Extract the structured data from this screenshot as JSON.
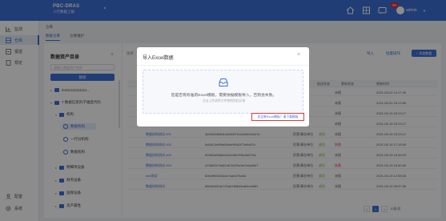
{
  "app": {
    "title": "PBC-DRAS",
    "subtitle": "人行数据上报",
    "notif_count": "99",
    "username": "admin"
  },
  "nav": [
    {
      "label": "监测",
      "icon": "chart-icon"
    },
    {
      "label": "仓库",
      "icon": "database-icon"
    },
    {
      "label": "报送",
      "icon": "send-icon"
    },
    {
      "label": "规定",
      "icon": "doc-icon"
    },
    {
      "label": "配置",
      "icon": "user-icon"
    },
    {
      "label": "系统",
      "icon": "gear-icon"
    }
  ],
  "breadcrumb": "仓库",
  "tabs": [
    {
      "label": "数据仓库"
    },
    {
      "label": "仓库维护"
    }
  ],
  "tree": {
    "title": "数据资产目录",
    "search_placeholder": "请输入数据资产名称",
    "button_label": "搜索",
    "nodes": [
      {
        "label": "test11111111111..."
      },
      {
        "label": "7 数据信息的子维度代码"
      },
      {
        "label": "机构"
      },
      {
        "label": "数据机构"
      },
      {
        "label": "一行分机构"
      },
      {
        "label": "数据机构"
      },
      {
        "label": "明细项设备"
      },
      {
        "label": "财务设备"
      },
      {
        "label": "国保设备"
      },
      {
        "label": "资产属性"
      }
    ]
  },
  "toolbar": {
    "search_placeholder": "搜索",
    "tools": [
      "导入",
      "批量操作"
    ],
    "add_label": "+ 添加数据"
  },
  "table": {
    "headers": [
      "报送状态",
      "更新状态",
      "更新时间"
    ],
    "rows": [
      {
        "name": "",
        "code": "",
        "c1": "",
        "c2": "",
        "c3": "未报",
        "time": "2021-05-22 14:17:40"
      },
      {
        "name": "",
        "code": "",
        "c1": "",
        "c2": "",
        "c3": "未报",
        "time": "2021-05-20 15:13:06"
      },
      {
        "name": "",
        "code": "",
        "c1": "",
        "c2": "",
        "c3": "未报",
        "time": "2021-05-19 23:23:17"
      },
      {
        "name": "",
        "code": "",
        "c1": "",
        "c2": "",
        "c3": "未报",
        "time": "2021-05-19 23:23:17"
      },
      {
        "name": "数据机构测试-001",
        "code": "3b0542f8b64b4c9e8f7b1a5d9e5c5e7a",
        "c1": "民营/事业单位",
        "c2": "成功",
        "c3": "未报",
        "time": "2021-05-19 23:23:17"
      },
      {
        "name": "数据机构测试-002",
        "code": "5c8d12e8f9a64b0e9f0d1f73e9d57c",
        "c1": "民营/事业单位",
        "c2": "成功",
        "c3": "失败",
        "time": "2021-05-19 17:15:00"
      },
      {
        "name": "数据机构测试-003",
        "code": "80362a89d8e6441d8e7f96c3e87f4c",
        "c1": "民营/事业单位",
        "c2": "成功",
        "c3": "未报",
        "time": "2021-05-19 15:45:23"
      },
      {
        "name": "数据机构测试-004",
        "code": "2038b3470a814b76d7be5e7c6a83b7",
        "c1": "民营/事业单位",
        "c2": "成功",
        "c3": "失败",
        "time": "2021-05-19 15:40:00"
      },
      {
        "name": "test测试",
        "code": "60b4f9f4323a4c7aab370a6d",
        "c1": "民营/事业单位",
        "c2": "成功",
        "c3": "未报",
        "time": "2021-05-19 12:55:43"
      },
      {
        "name": "数据机构测试",
        "code": "88b3e5813e720a61f68d9ed64c6d5f1",
        "c1": "民营/事业单位",
        "c2": "成功",
        "c3": "未报",
        "time": "2021-05-12 09:57:36"
      }
    ]
  },
  "pager": {
    "prev": "<",
    "page": "1",
    "next": ">",
    "size": "10条/页"
  },
  "modal": {
    "title": "导入Excel数据",
    "close": "×",
    "drop_text": "您是否有标准的Excel模板，需要依据模板导入，否则会失败。",
    "drop_sub": "点击上传或将文件拖拽到此区域",
    "download_hint": "还没有Excel模板？请下载模板"
  },
  "colors": {
    "primary": "#3d6fd6",
    "danger": "#e53935"
  }
}
